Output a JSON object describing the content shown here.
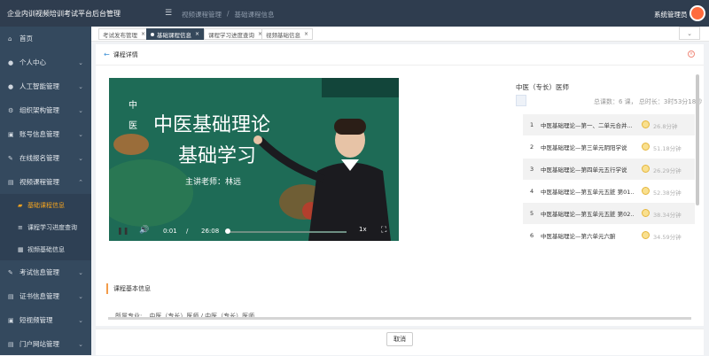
{
  "app": {
    "title": "企业内训视频培训考试平台后台管理",
    "menu_icon": "hamburger-icon"
  },
  "breadcrumb": {
    "items": [
      "视频课程管理",
      "基础课程信息"
    ]
  },
  "user": {
    "name": "系统管理员"
  },
  "sidebar": {
    "items": [
      {
        "label": "首页",
        "icon": "home-icon",
        "has_children": false
      },
      {
        "label": "个人中心",
        "icon": "user-icon",
        "has_children": true
      },
      {
        "label": "人工智能管理",
        "icon": "user-icon",
        "has_children": true
      },
      {
        "label": "组织架构管理",
        "icon": "org-icon",
        "has_children": true
      },
      {
        "label": "账号信息管理",
        "icon": "account-icon",
        "has_children": true
      },
      {
        "label": "在线报名管理",
        "icon": "signup-icon",
        "has_children": true
      },
      {
        "label": "视频课程管理",
        "icon": "video-icon",
        "has_children": true
      },
      {
        "label": "考试信息管理",
        "icon": "exam-icon",
        "has_children": true
      },
      {
        "label": "证书信息管理",
        "icon": "certificate-icon",
        "has_children": true
      },
      {
        "label": "短视频管理",
        "icon": "short-video-icon",
        "has_children": true
      },
      {
        "label": "门户网站管理",
        "icon": "portal-icon",
        "has_children": true
      }
    ],
    "video_sub": [
      {
        "label": "基础课程信息",
        "active": true
      },
      {
        "label": "课程学习进度查询",
        "active": false
      },
      {
        "label": "视频基础信息",
        "active": false
      }
    ]
  },
  "tabs": [
    {
      "label": "考试发布管理",
      "active": false
    },
    {
      "label": "基础课程信息",
      "active": true
    },
    {
      "label": "课程学习进度查询",
      "active": false
    },
    {
      "label": "视频基础信息",
      "active": false
    }
  ],
  "panel": {
    "title": "课程详情"
  },
  "video": {
    "slide_tag_1": "中",
    "slide_tag_2": "医",
    "slide_title_1": "中医基础理论",
    "slide_title_2": "基础学习",
    "slide_teacher": "主讲老师：林远",
    "current_time": "0:01",
    "separator": "/",
    "total_time": "26:08",
    "speed": "1x",
    "progress": 0.001
  },
  "course": {
    "name": "中医（专长）医师",
    "lesson_count_label": "总课数：",
    "lesson_count": "6 课，",
    "duration_label": "总时长：",
    "duration": "3时53分18秒"
  },
  "lessons": [
    {
      "index": "1",
      "name": "中医基础理论—第一、二单元合并...",
      "duration": "26.8分钟"
    },
    {
      "index": "2",
      "name": "中医基础理论—第三单元阴阳学说",
      "duration": "51.18分钟"
    },
    {
      "index": "3",
      "name": "中医基础理论—第四单元五行学说",
      "duration": "26.29分钟"
    },
    {
      "index": "4",
      "name": "中医基础理论—第五单元五脏 第01...",
      "duration": "52.38分钟"
    },
    {
      "index": "5",
      "name": "中医基础理论—第五单元五脏 第02...",
      "duration": "38.34分钟"
    },
    {
      "index": "6",
      "name": "中医基础理论—第六单元六腑",
      "duration": "34.59分钟"
    }
  ],
  "info": {
    "section_title": "课程基本信息",
    "specialty_label": "所属专业:",
    "specialty_value": "中医（专长）医师 / 中医（专长）医师"
  },
  "actions": {
    "cancel_label": "取消"
  }
}
